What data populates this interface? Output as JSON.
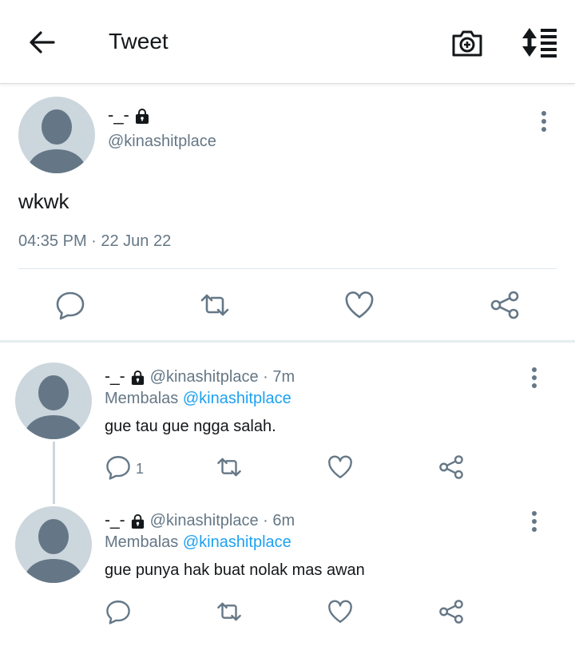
{
  "header": {
    "title": "Tweet",
    "back_icon": "arrow-left-icon",
    "camera_icon": "camera-plus-icon",
    "sort_icon": "sort-icon"
  },
  "tweet": {
    "name": "-_-",
    "handle": "@kinashitplace",
    "text": "wkwk",
    "timestamp": "04:35 PM · 22 Jun 22"
  },
  "replies": [
    {
      "name": "-_-",
      "handle_time": "@kinashitplace · 7m",
      "reply_prefix": "Membalas",
      "reply_to": "@kinashitplace",
      "text": "gue tau gue ngga salah.",
      "reply_count": "1"
    },
    {
      "name": "-_-",
      "handle_time": "@kinashitplace · 6m",
      "reply_prefix": "Membalas",
      "reply_to": "@kinashitplace",
      "text": "gue punya hak buat nolak mas awan",
      "reply_count": ""
    }
  ],
  "colors": {
    "text": "#14171a",
    "secondary": "#657786",
    "link": "#1da1f2",
    "avatar_bg": "#ccd6dd",
    "avatar_fg": "#657786"
  }
}
